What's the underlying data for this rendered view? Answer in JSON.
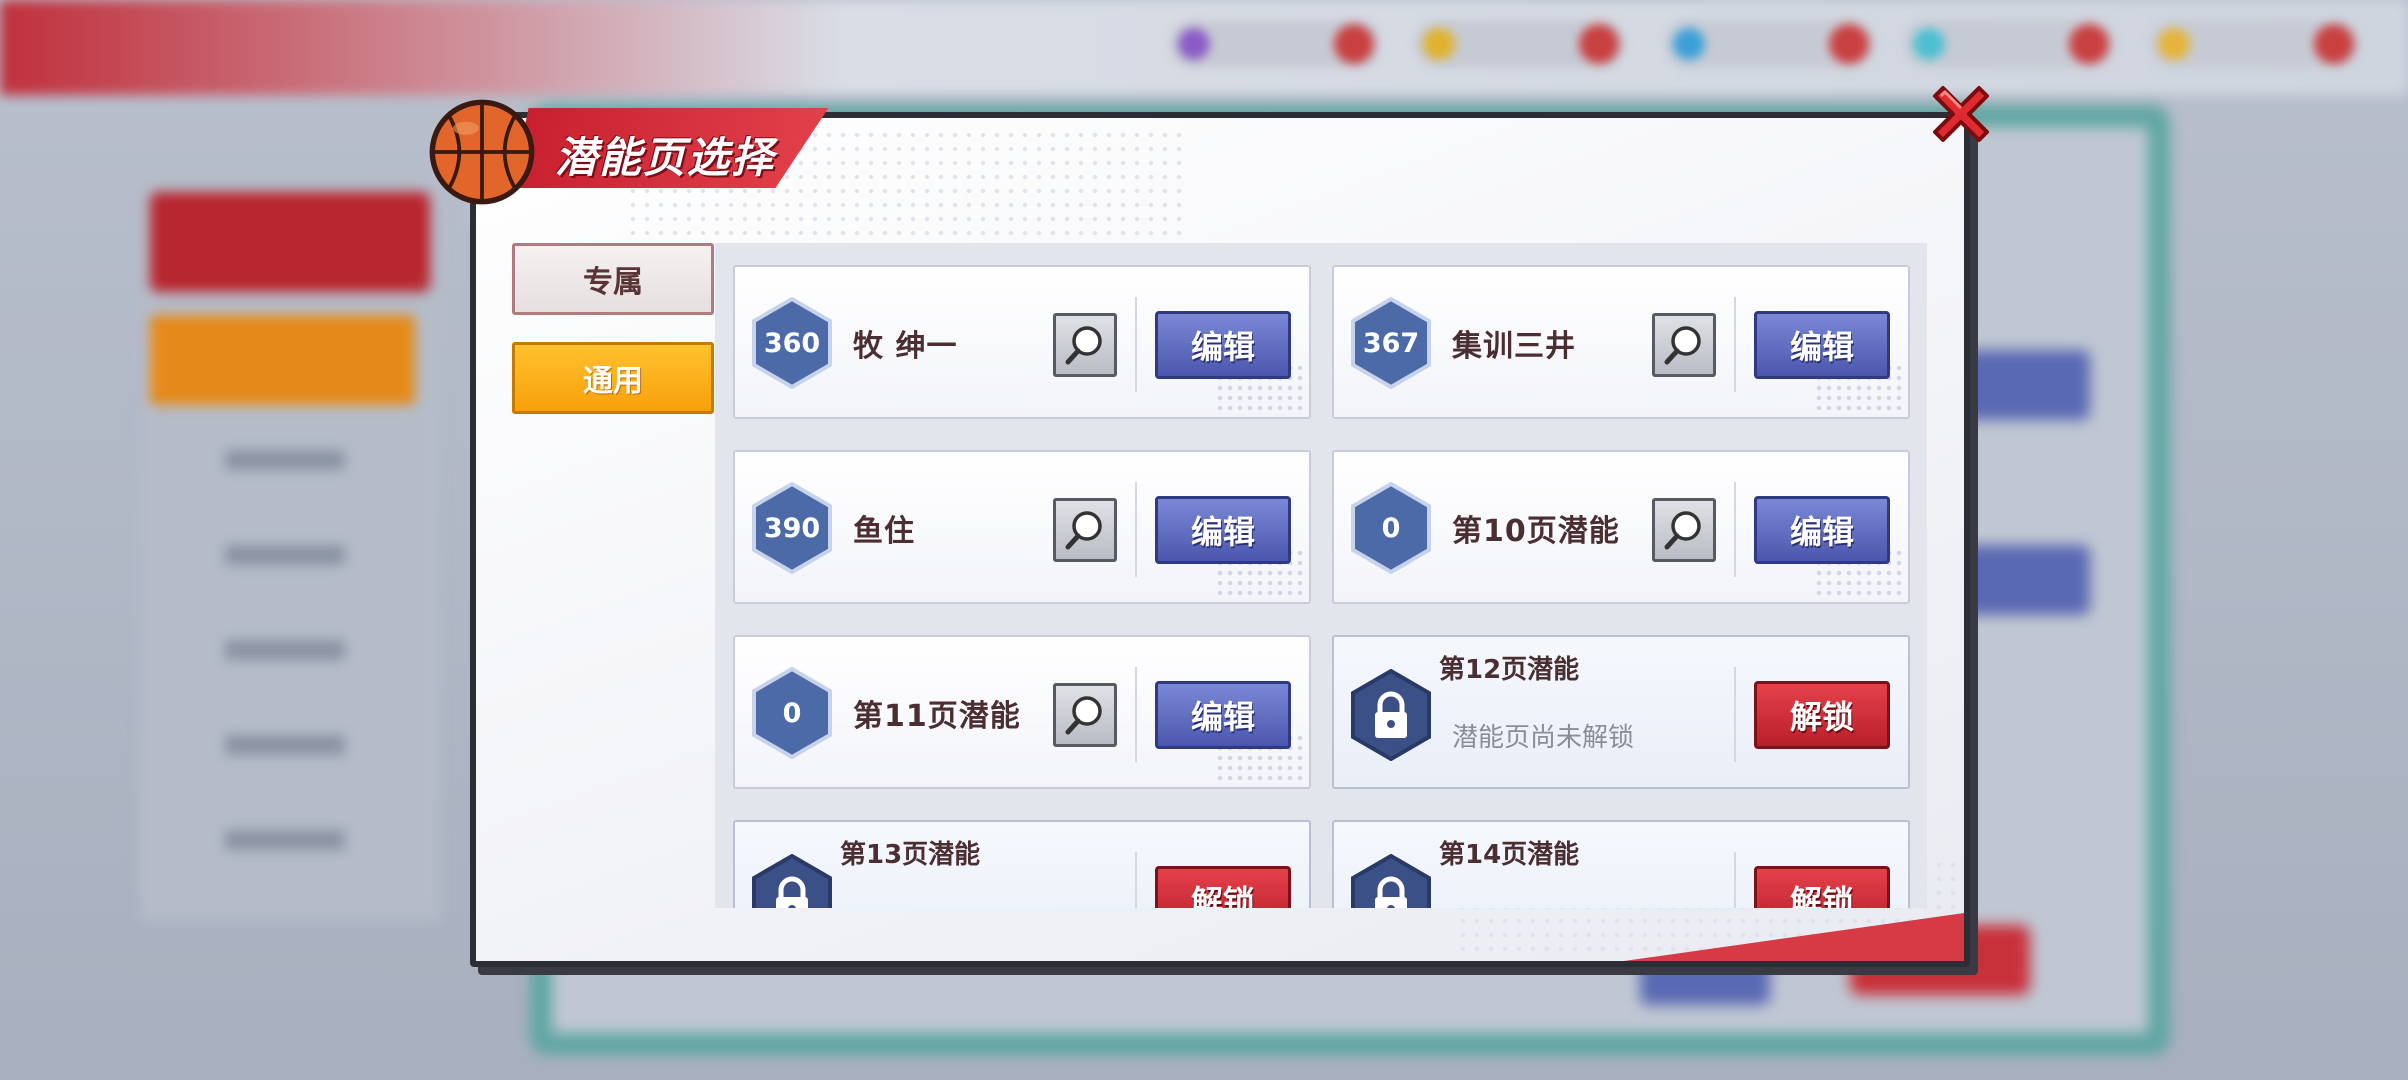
{
  "dialog": {
    "title": "潜能页选择",
    "tabs": [
      {
        "label": "专属",
        "active": false
      },
      {
        "label": "通用",
        "active": true
      }
    ]
  },
  "pages": [
    {
      "level": "360",
      "name": "牧 绅一",
      "locked": false,
      "action": "编辑"
    },
    {
      "level": "367",
      "name": "集训三井",
      "locked": false,
      "action": "编辑"
    },
    {
      "level": "390",
      "name": "鱼住",
      "locked": false,
      "action": "编辑"
    },
    {
      "level": "0",
      "name": "第10页潜能",
      "locked": false,
      "action": "编辑"
    },
    {
      "level": "0",
      "name": "第11页潜能",
      "locked": false,
      "action": "编辑"
    },
    {
      "name": "第12页潜能",
      "locked": true,
      "status": "潜能页尚未解锁",
      "action": "解锁"
    },
    {
      "name": "第13页潜能",
      "locked": true,
      "action": "解锁"
    },
    {
      "name": "第14页潜能",
      "locked": true,
      "action": "解锁"
    }
  ],
  "colors": {
    "accent_red": "#d63a45",
    "edit_blue": "#5a66bf",
    "tab_active": "#f9a915",
    "hex_blue": "#4c6aa8"
  },
  "icons": [
    "basketball-icon",
    "close-icon",
    "magnifier-icon",
    "lock-icon"
  ]
}
